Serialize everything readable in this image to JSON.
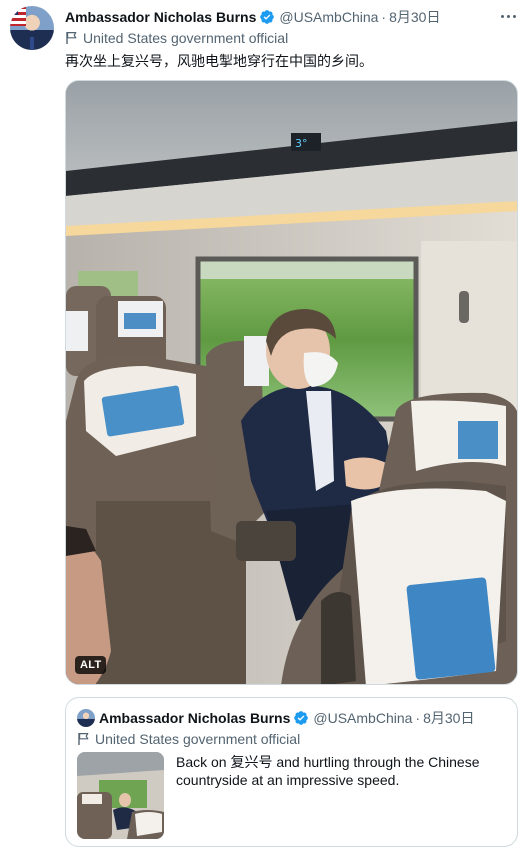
{
  "tweet": {
    "author_name": "Ambassador Nicholas Burns",
    "handle": "@USAmbChina",
    "separator": "·",
    "date": "8月30日",
    "affiliation": "United States government official",
    "text": "再次坐上复兴号，风驰电掣地穿行在中国的乡间。",
    "media": {
      "alt_badge": "ALT"
    }
  },
  "quoted_tweet": {
    "author_name": "Ambassador Nicholas Burns",
    "handle": "@USAmbChina",
    "separator": "·",
    "date": "8月30日",
    "affiliation": "United States government official",
    "text": "Back on 复兴号 and hurtling through the Chinese countryside at an impressive speed."
  },
  "colors": {
    "text_primary": "#0f1419",
    "text_secondary": "#536471",
    "verified_blue": "#1d9bf0",
    "border": "#cfd9de"
  },
  "icons": [
    "verified-badge-icon",
    "government-flag-icon",
    "more-options-icon"
  ]
}
